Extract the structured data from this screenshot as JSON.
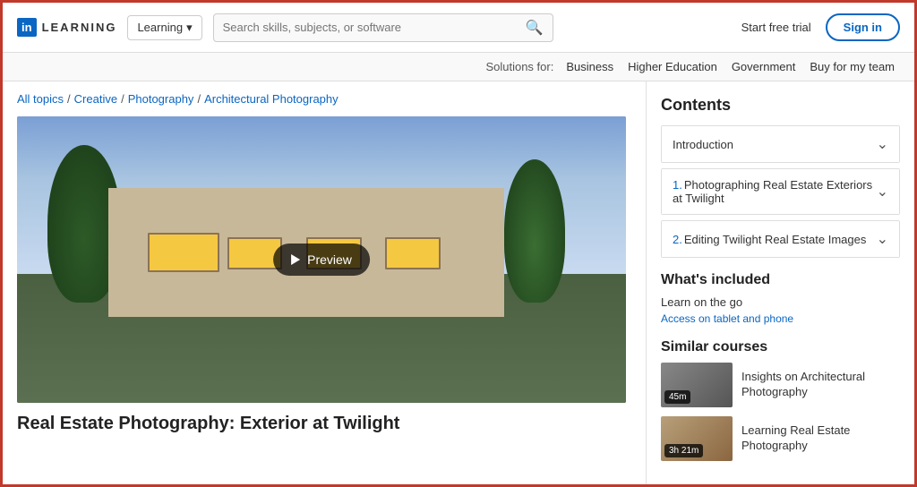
{
  "header": {
    "logo_box": "in",
    "logo_text": "LEARNING",
    "dropdown_label": "Learning",
    "search_placeholder": "Search skills, subjects, or software",
    "start_free_label": "Start free trial",
    "sign_in_label": "Sign in"
  },
  "sub_nav": {
    "solutions_label": "Solutions for:",
    "links": [
      "Business",
      "Higher Education",
      "Government",
      "Buy for my team"
    ]
  },
  "breadcrumb": {
    "items": [
      {
        "label": "All topics",
        "href": "#"
      },
      {
        "label": "Creative",
        "href": "#"
      },
      {
        "label": "Photography",
        "href": "#"
      },
      {
        "label": "Architectural Photography",
        "href": "#"
      }
    ]
  },
  "preview": {
    "button_label": "Preview"
  },
  "course": {
    "title": "Real Estate Photography: Exterior at Twilight"
  },
  "sidebar": {
    "contents_title": "Contents",
    "contents_items": [
      {
        "label": "Introduction",
        "number": ""
      },
      {
        "label": "Photographing Real Estate Exteriors at Twilight",
        "number": "1."
      },
      {
        "label": "Editing Twilight Real Estate Images",
        "number": "2."
      }
    ],
    "whats_included_title": "What's included",
    "learn_on_go": "Learn on the go",
    "access_label": "Access on tablet and phone",
    "similar_courses_title": "Similar courses",
    "similar": [
      {
        "title": "Insights on Architectural Photography",
        "duration": "45m",
        "thumb": "1"
      },
      {
        "title": "Learning Real Estate Photography",
        "duration": "3h 21m",
        "thumb": "2"
      }
    ]
  }
}
